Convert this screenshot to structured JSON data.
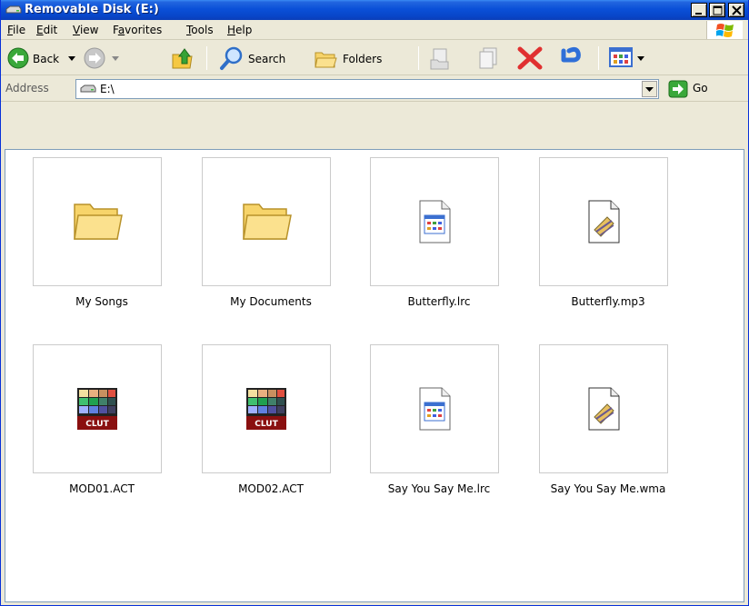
{
  "window": {
    "title": "Removable Disk (E:)",
    "controls": {
      "minimize": "_",
      "maximize": "□",
      "close": "×"
    }
  },
  "menu": {
    "items": [
      {
        "label": "File",
        "accel": "F"
      },
      {
        "label": "Edit",
        "accel": "E"
      },
      {
        "label": "View",
        "accel": "V"
      },
      {
        "label": "Favorites",
        "accel": "a"
      },
      {
        "label": "Tools",
        "accel": "T"
      },
      {
        "label": "Help",
        "accel": "H"
      }
    ]
  },
  "toolbar": {
    "back_label": "Back",
    "search_label": "Search",
    "folders_label": "Folders"
  },
  "address": {
    "label": "Address",
    "value": "E:\\",
    "go_label": "Go"
  },
  "files": [
    {
      "name": "My Songs",
      "icon": "folder-icon"
    },
    {
      "name": "My Documents",
      "icon": "folder-icon"
    },
    {
      "name": "Butterfly.lrc",
      "icon": "document-icon"
    },
    {
      "name": "Butterfly.mp3",
      "icon": "media-file-icon"
    },
    {
      "name": "MOD01.ACT",
      "icon": "clut-icon"
    },
    {
      "name": "MOD02.ACT",
      "icon": "clut-icon"
    },
    {
      "name": "Say You Say Me.lrc",
      "icon": "document-icon"
    },
    {
      "name": "Say You Say Me.wma",
      "icon": "media-file-icon"
    }
  ],
  "colors": {
    "titlebar": "#0a50d8",
    "chrome": "#ece9d8",
    "delete_red": "#e03030",
    "folder_yellow": "#f7d46a"
  }
}
